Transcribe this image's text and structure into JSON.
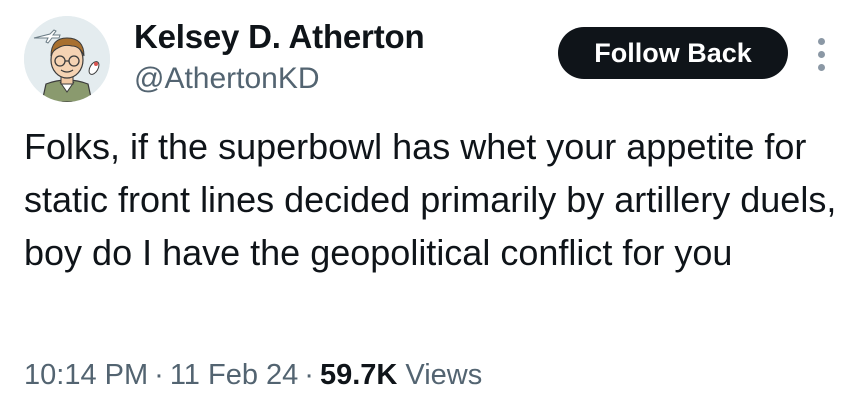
{
  "author": {
    "display_name": "Kelsey D. Atherton",
    "handle": "@AthertonKD"
  },
  "actions": {
    "follow_label": "Follow Back",
    "more_icon": "more-vertical-icon"
  },
  "tweet": {
    "text": "Folks, if the superbowl has whet your appetite for static front lines decided primarily by artillery duels, boy do I have the geopolitical conflict for you",
    "time": "10:14 PM",
    "date": "11 Feb 24",
    "separator": "·",
    "views_count": "59.7K",
    "views_label": "Views"
  },
  "colors": {
    "primary_text": "#0f1419",
    "secondary_text": "#536471",
    "button_bg": "#0f1419",
    "button_text": "#ffffff"
  }
}
